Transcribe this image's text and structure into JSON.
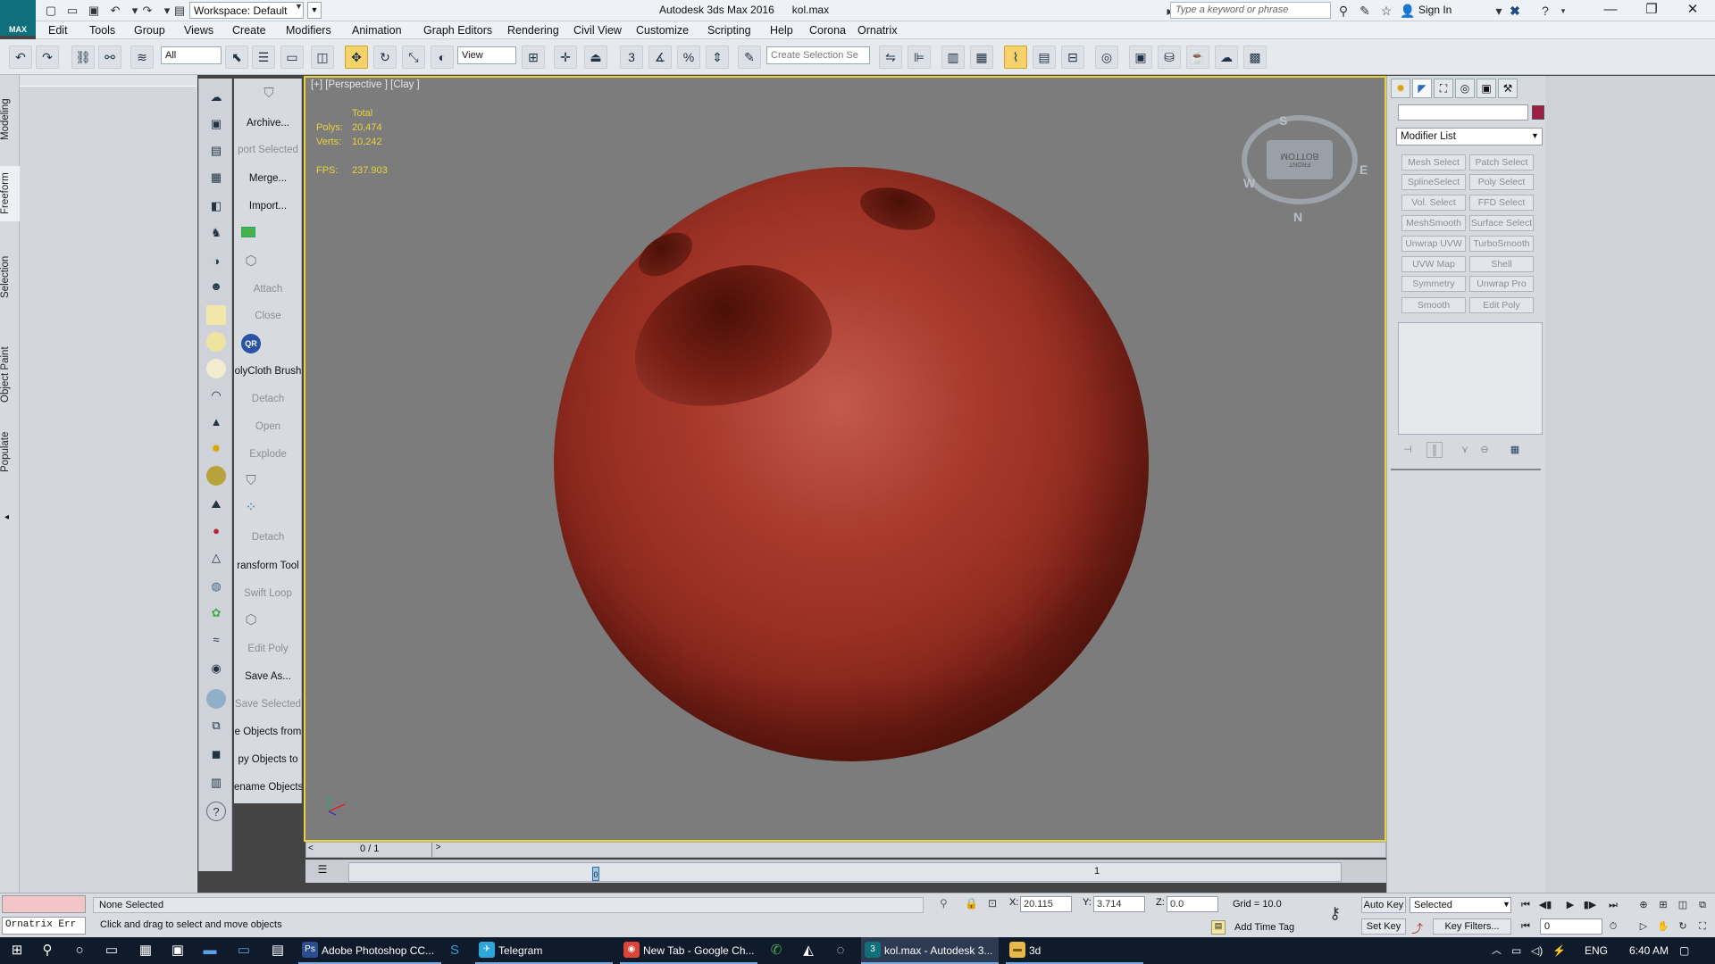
{
  "window": {
    "app_title": "Autodesk 3ds Max 2016",
    "file_name": "kol.max",
    "logo_label": "MAX",
    "workspace": "Workspace: Default",
    "search_placeholder": "Type a keyword or phrase",
    "sign_in": "Sign In"
  },
  "menu": [
    "Edit",
    "Tools",
    "Group",
    "Views",
    "Create",
    "Modifiers",
    "Animation",
    "Graph Editors",
    "Rendering",
    "Civil View",
    "Customize",
    "Scripting",
    "Help",
    "Corona",
    "Ornatrix"
  ],
  "toolbar": {
    "filter_select": "All",
    "ref_coord": "View",
    "selection_set_placeholder": "Create Selection Se"
  },
  "ribbon_tabs": [
    "Modeling",
    "Freeform",
    "Selection",
    "Object Paint",
    "Populate"
  ],
  "commands": [
    {
      "label": "Archive...",
      "enabled": true
    },
    {
      "label": "port Selected",
      "enabled": false
    },
    {
      "label": "Merge...",
      "enabled": true
    },
    {
      "label": "Import...",
      "enabled": true
    },
    {
      "label": "Attach",
      "enabled": false
    },
    {
      "label": "Close",
      "enabled": false
    },
    {
      "label": "olyCloth Brush",
      "enabled": true
    },
    {
      "label": "Detach",
      "enabled": false
    },
    {
      "label": "Open",
      "enabled": false
    },
    {
      "label": "Explode",
      "enabled": false
    },
    {
      "label": "Detach",
      "enabled": false
    },
    {
      "label": "ransform Tool",
      "enabled": true
    },
    {
      "label": "Swift Loop",
      "enabled": false
    },
    {
      "label": "Edit Poly",
      "enabled": false
    },
    {
      "label": "Save As...",
      "enabled": true
    },
    {
      "label": "Save Selected",
      "enabled": false
    },
    {
      "label": "e Objects from",
      "enabled": true
    },
    {
      "label": "py Objects to",
      "enabled": true
    },
    {
      "label": "ename Objects",
      "enabled": true
    }
  ],
  "qr_badge": "QR",
  "viewport": {
    "label": "[+] [Perspective ] [Clay ]",
    "stats_header": "Total",
    "polys_label": "Polys:",
    "polys_value": "20,474",
    "verts_label": "Verts:",
    "verts_value": "10,242",
    "fps_label": "FPS:",
    "fps_value": "237.903",
    "viewcube_face": "BOTTOM",
    "viewcube_face2": "FRONT",
    "compass": {
      "n": "N",
      "s": "S",
      "e": "E",
      "w": "W"
    },
    "object_color": "#a8392b"
  },
  "timeline": {
    "slider": "0 / 1",
    "tick_label": "1",
    "key_marker": "0"
  },
  "command_panel": {
    "modifier_list": "Modifier List",
    "object_color": "#a01e44",
    "modifiers": [
      "Mesh Select",
      "Patch Select",
      "SplineSelect",
      "Poly Select",
      "Vol. Select",
      "FFD Select",
      "MeshSmooth",
      "Surface Select",
      "Unwrap UVW",
      "TurboSmooth",
      "UVW Map",
      "Shell",
      "Symmetry",
      "Unwrap Pro",
      "Smooth",
      "Edit Poly"
    ]
  },
  "status": {
    "script_error": "Ornatrix Err",
    "selection": "None Selected",
    "prompt": "Click and drag to select and move objects",
    "x_label": "X:",
    "x_value": "20.115",
    "y_label": "Y:",
    "y_value": "3.714",
    "z_label": "Z:",
    "z_value": "0.0",
    "grid": "Grid = 10.0",
    "add_time_tag": "Add Time Tag",
    "auto_key": "Auto Key",
    "set_key": "Set Key",
    "selected_set": "Selected",
    "key_filters": "Key Filters...",
    "frame": "0"
  },
  "taskbar": {
    "apps": [
      {
        "label": "Adobe Photoshop CC...",
        "icon": "Ps",
        "color": "#2a4d8f"
      },
      {
        "label": "Telegram",
        "icon": "✈",
        "color": "#2ea6da"
      },
      {
        "label": "New Tab - Google Ch...",
        "icon": "◉",
        "color": "#db4437"
      },
      {
        "label": "kol.max - Autodesk 3...",
        "icon": "3",
        "color": "#0f6f7a"
      },
      {
        "label": "3d",
        "icon": "▬",
        "color": "#e8b84a"
      }
    ],
    "lang": "ENG",
    "time": "6:40 AM"
  }
}
